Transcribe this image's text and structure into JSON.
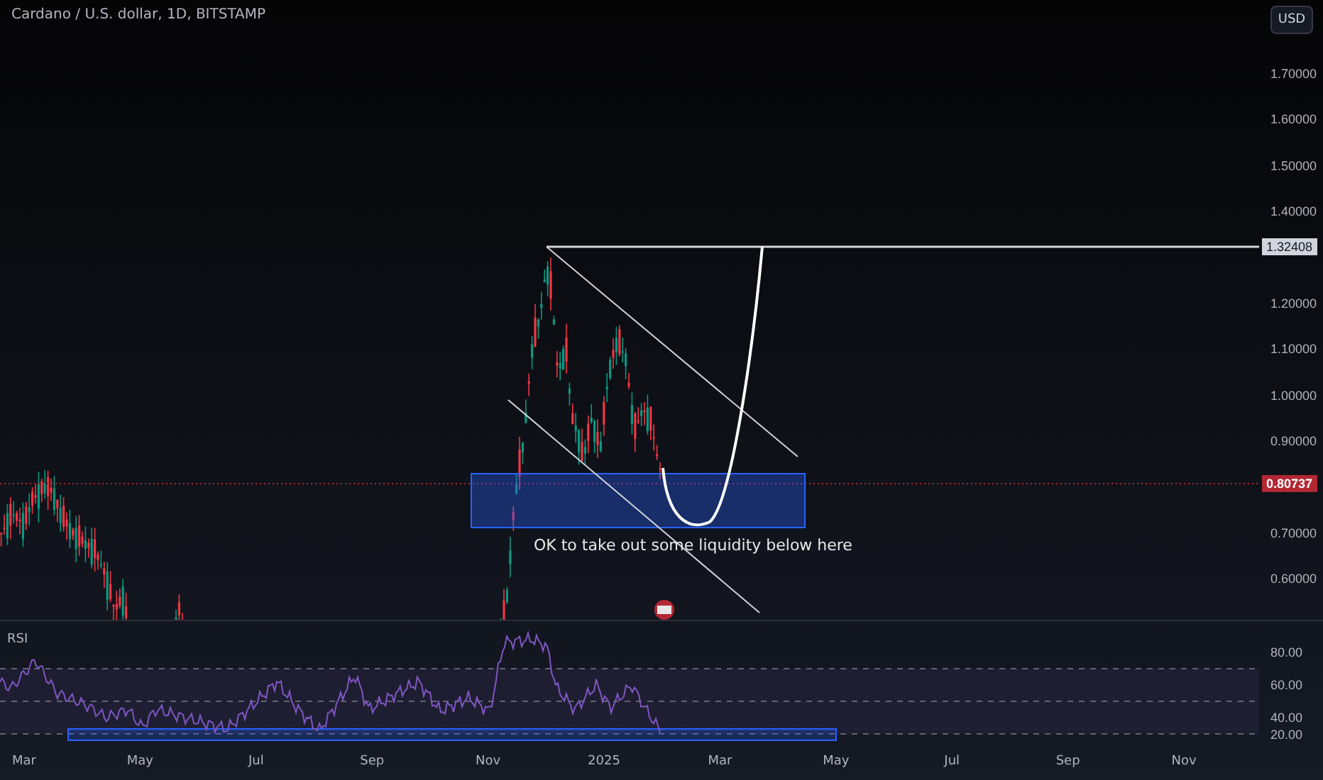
{
  "header": {
    "symbol": "Cardano / U.S. dollar, 1D, BITSTAMP"
  },
  "currency_button": "USD",
  "price_axis": {
    "tick_groups": [
      [
        "1.70000",
        "1.60000",
        "1.50000",
        "1.40000"
      ],
      [
        "1.20000",
        "1.10000",
        "1.00000",
        "0.90000"
      ],
      [
        "0.70000",
        "0.60000"
      ]
    ]
  },
  "price_tags": [
    {
      "label": "1.32408",
      "kind": "drawing"
    },
    {
      "label": "0.80737",
      "kind": "last"
    }
  ],
  "annotation": "OK to take out some liquidity below here",
  "rsi": {
    "title": "RSI",
    "ticks": [
      "80.00",
      "60.00",
      "40.00",
      "20.00"
    ]
  },
  "time_axis": [
    "Mar",
    "May",
    "Jul",
    "Sep",
    "Nov",
    "2025",
    "Mar",
    "May",
    "Jul",
    "Sep",
    "Nov"
  ]
}
